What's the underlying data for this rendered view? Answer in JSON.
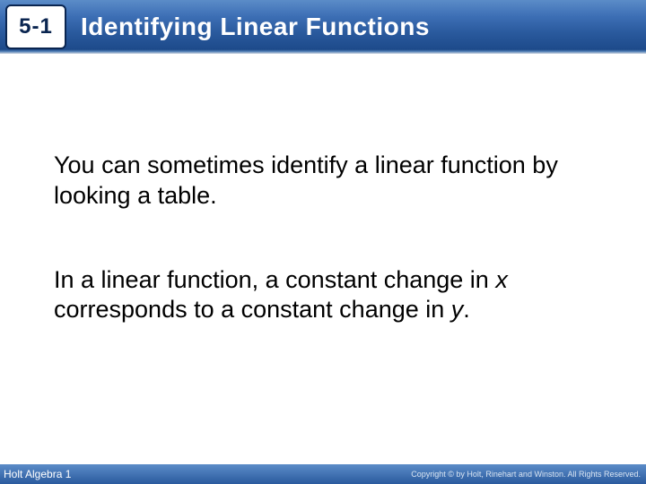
{
  "header": {
    "section_number": "5-1",
    "lesson_title": "Identifying Linear Functions"
  },
  "body": {
    "para1": "You can sometimes identify a linear function by looking a table.",
    "para2_pre": "In a linear function, a constant change in ",
    "para2_x": "x",
    "para2_mid": " corresponds to a constant change in ",
    "para2_y": "y",
    "para2_post": "."
  },
  "footer": {
    "book_title": "Holt Algebra 1",
    "copyright": "Copyright © by Holt, Rinehart and Winston. All Rights Reserved."
  }
}
